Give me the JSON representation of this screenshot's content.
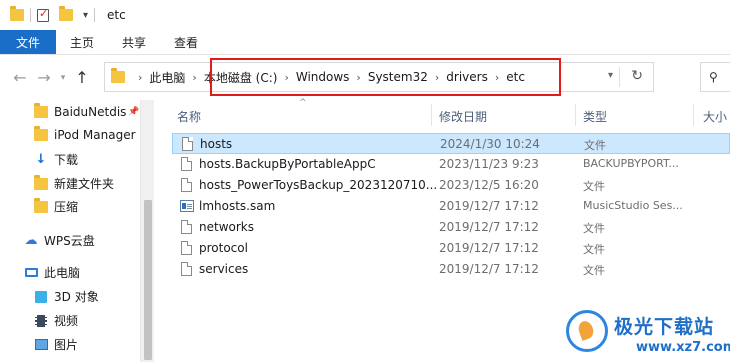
{
  "window": {
    "title": "etc"
  },
  "ribbon": {
    "tabs": [
      "文件",
      "主页",
      "共享",
      "查看"
    ]
  },
  "address": {
    "crumbs": [
      "此电脑",
      "本地磁盘 (C:)",
      "Windows",
      "System32",
      "drivers",
      "etc"
    ],
    "search_icon": "search-icon"
  },
  "sidebar": {
    "items": [
      {
        "label": "BaiduNetdis",
        "icon": "folder-icon",
        "pinned": true
      },
      {
        "label": "iPod Manager",
        "icon": "folder-icon"
      },
      {
        "label": "下载",
        "icon": "download-icon"
      },
      {
        "label": "新建文件夹",
        "icon": "folder-icon"
      },
      {
        "label": "压缩",
        "icon": "folder-icon"
      },
      {
        "label": "WPS云盘",
        "icon": "cloud-icon"
      },
      {
        "label": "此电脑",
        "icon": "pc-icon"
      },
      {
        "label": "3D 对象",
        "icon": "cube-icon"
      },
      {
        "label": "视频",
        "icon": "video-icon"
      },
      {
        "label": "图片",
        "icon": "picture-icon"
      }
    ]
  },
  "columns": {
    "name": "名称",
    "date": "修改日期",
    "type": "类型",
    "size": "大小"
  },
  "files": [
    {
      "name": "hosts",
      "date": "2024/1/30 10:24",
      "type": "文件",
      "icon": "document-icon",
      "selected": true
    },
    {
      "name": "hosts.BackupByPortableAppC",
      "date": "2023/11/23 9:23",
      "type": "BACKUPBYPORT...",
      "icon": "document-icon"
    },
    {
      "name": "hosts_PowerToysBackup_2023120710...",
      "date": "2023/12/5 16:20",
      "type": "文件",
      "icon": "document-icon"
    },
    {
      "name": "lmhosts.sam",
      "date": "2019/12/7 17:12",
      "type": "MusicStudio Ses...",
      "icon": "sam-file-icon"
    },
    {
      "name": "networks",
      "date": "2019/12/7 17:12",
      "type": "文件",
      "icon": "document-icon"
    },
    {
      "name": "protocol",
      "date": "2019/12/7 17:12",
      "type": "文件",
      "icon": "document-icon"
    },
    {
      "name": "services",
      "date": "2019/12/7 17:12",
      "type": "文件",
      "icon": "document-icon"
    }
  ],
  "watermark": {
    "title": "极光下载站",
    "url": "www.xz7.com"
  },
  "colors": {
    "accent": "#1a6ec8",
    "highlight_box": "#e11a1a",
    "selection": "#cce8ff"
  }
}
